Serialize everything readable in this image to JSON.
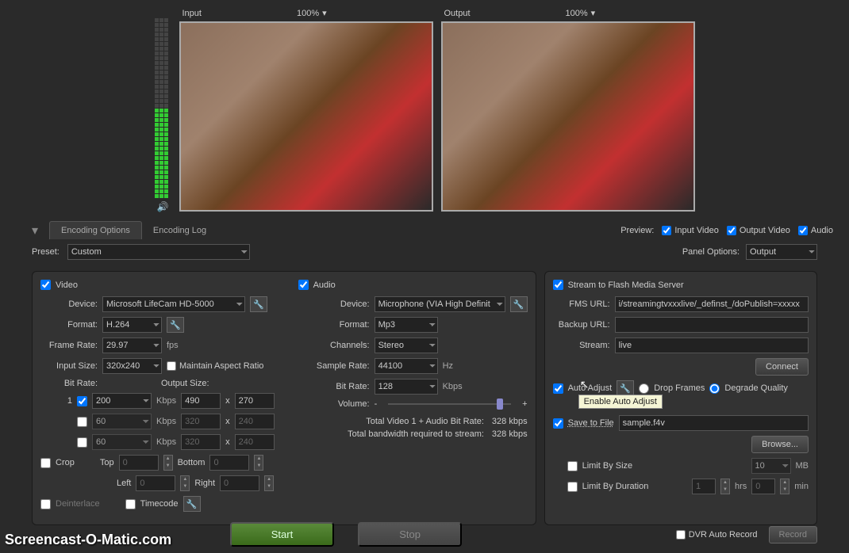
{
  "preview": {
    "input_label": "Input",
    "output_label": "Output",
    "zoom_input": "100%",
    "zoom_output": "100%",
    "toggle_label": "Preview:",
    "toggle_input": "Input Video",
    "toggle_output": "Output Video",
    "toggle_audio": "Audio"
  },
  "tabs": {
    "options": "Encoding Options",
    "log": "Encoding Log"
  },
  "preset": {
    "label": "Preset:",
    "value": "Custom"
  },
  "panel_options": {
    "label": "Panel Options:",
    "value": "Output"
  },
  "video": {
    "section": "Video",
    "device_label": "Device:",
    "device": "Microsoft LifeCam HD-5000",
    "format_label": "Format:",
    "format": "H.264",
    "framerate_label": "Frame Rate:",
    "framerate": "29.97",
    "fps": "fps",
    "inputsize_label": "Input Size:",
    "inputsize": "320x240",
    "maintain_aspect": "Maintain Aspect Ratio",
    "bitrate_label": "Bit Rate:",
    "outputsize_label": "Output Size:",
    "br_row1_idx": "1",
    "br_row1_val": "200",
    "kbps": "Kbps",
    "out_w1": "490",
    "out_h1": "270",
    "br_row2_val": "60",
    "out_w2": "320",
    "out_h2": "240",
    "br_row3_val": "60",
    "out_w3": "320",
    "out_h3": "240",
    "x": "x",
    "crop": "Crop",
    "top": "Top",
    "bottom": "Bottom",
    "left": "Left",
    "right": "Right",
    "zero": "0",
    "deinterlace": "Deinterlace",
    "timecode": "Timecode"
  },
  "audio": {
    "section": "Audio",
    "device_label": "Device:",
    "device": "Microphone (VIA High Definition",
    "format_label": "Format:",
    "format": "Mp3",
    "channels_label": "Channels:",
    "channels": "Stereo",
    "samplerate_label": "Sample Rate:",
    "samplerate": "44100",
    "hz": "Hz",
    "bitrate_label": "Bit Rate:",
    "bitrate": "128",
    "kbps": "Kbps",
    "volume_label": "Volume:",
    "minus": "-",
    "plus": "+"
  },
  "totals": {
    "total_video": "Total Video 1 + Audio Bit Rate:",
    "total_bw": "Total bandwidth required to stream:",
    "value": "328 kbps"
  },
  "stream": {
    "section": "Stream to Flash Media Server",
    "fms_label": "FMS URL:",
    "fms": "i/streamingtvxxxlive/_definst_/doPublish=xxxxx",
    "backup_label": "Backup URL:",
    "backup": "",
    "stream_label": "Stream:",
    "stream": "live",
    "connect": "Connect",
    "auto_adjust": "Auto Adjust",
    "drop_frames": "Drop Frames",
    "degrade": "Degrade Quality",
    "tooltip": "Enable Auto Adjust",
    "save_to_file": "Save to File",
    "filename": "sample.f4v",
    "browse": "Browse...",
    "limit_size": "Limit By Size",
    "limit_size_val": "10",
    "mb": "MB",
    "limit_dur": "Limit By Duration",
    "limit_dur_val": "1",
    "hrs": "hrs",
    "min_val": "0",
    "min": "min"
  },
  "bottom": {
    "start": "Start",
    "stop": "Stop",
    "dvr": "DVR Auto Record",
    "record": "Record"
  },
  "watermark": "Screencast-O-Matic.com"
}
